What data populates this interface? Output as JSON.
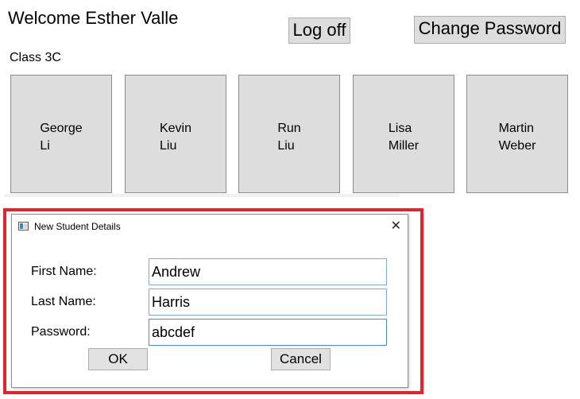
{
  "header": {
    "welcome": "Welcome Esther Valle",
    "logoff_label": "Log off",
    "change_password_label": "Change Password"
  },
  "class_label": "Class 3C",
  "students": [
    {
      "first": "George",
      "last": "Li"
    },
    {
      "first": "Kevin",
      "last": "Liu"
    },
    {
      "first": "Run",
      "last": "Liu"
    },
    {
      "first": "Lisa",
      "last": "Miller"
    },
    {
      "first": "Martin",
      "last": "Weber"
    }
  ],
  "dialog": {
    "title": "New Student Details",
    "close_glyph": "✕",
    "first_name_label": "First Name:",
    "first_name_value": "Andrew",
    "last_name_label": "Last Name:",
    "last_name_value": "Harris",
    "password_label": "Password:",
    "password_value": "abcdef",
    "ok_label": "OK",
    "cancel_label": "Cancel"
  },
  "colors": {
    "highlight": "#e0242c",
    "tile": "#dddddd"
  }
}
